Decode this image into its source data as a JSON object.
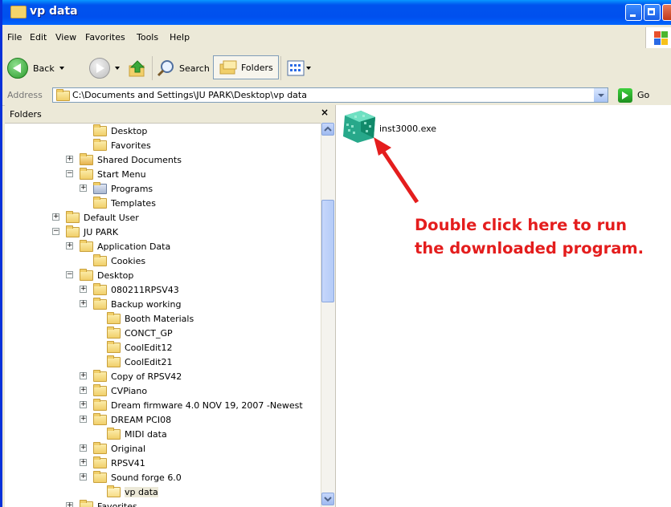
{
  "window": {
    "title": "vp data"
  },
  "menu": [
    "File",
    "Edit",
    "View",
    "Favorites",
    "Tools",
    "Help"
  ],
  "toolbar": {
    "back_label": "Back",
    "search_label": "Search",
    "folders_label": "Folders"
  },
  "address": {
    "label": "Address",
    "path": "C:\\Documents and Settings\\JU PARK\\Desktop\\vp data",
    "go_label": "Go"
  },
  "folders_pane": {
    "title": "Folders",
    "close": "×",
    "items": [
      {
        "label": "Desktop",
        "expander": ""
      },
      {
        "label": "Favorites",
        "expander": ""
      },
      {
        "label": "Shared Documents",
        "expander": "+"
      },
      {
        "label": "Start Menu",
        "expander": "−"
      },
      {
        "label": "Programs",
        "expander": "+"
      },
      {
        "label": "Templates",
        "expander": ""
      },
      {
        "label": "Default User",
        "expander": "+"
      },
      {
        "label": "JU PARK",
        "expander": "−"
      },
      {
        "label": "Application Data",
        "expander": "+"
      },
      {
        "label": "Cookies",
        "expander": ""
      },
      {
        "label": "Desktop",
        "expander": "−"
      },
      {
        "label": "080211RPSV43",
        "expander": "+"
      },
      {
        "label": "Backup working",
        "expander": "+"
      },
      {
        "label": "Booth Materials",
        "expander": ""
      },
      {
        "label": "CONCT_GP",
        "expander": ""
      },
      {
        "label": "CoolEdit12",
        "expander": ""
      },
      {
        "label": "CoolEdit21",
        "expander": ""
      },
      {
        "label": "Copy of RPSV42",
        "expander": "+"
      },
      {
        "label": "CVPiano",
        "expander": "+"
      },
      {
        "label": "Dream firmware 4.0 NOV 19, 2007 -Newest",
        "expander": "+"
      },
      {
        "label": "DREAM PCI08",
        "expander": "+"
      },
      {
        "label": "MIDI data",
        "expander": ""
      },
      {
        "label": "Original",
        "expander": "+"
      },
      {
        "label": "RPSV41",
        "expander": "+"
      },
      {
        "label": "Sound forge 6.0",
        "expander": "+"
      },
      {
        "label": "vp data",
        "expander": ""
      },
      {
        "label": "Favorites",
        "expander": "+"
      }
    ]
  },
  "content": {
    "file_name": "inst3000.exe"
  },
  "annotation": {
    "line1": "Double click here to run",
    "line2": "the downloaded program.",
    "color": "#e41d1d"
  }
}
